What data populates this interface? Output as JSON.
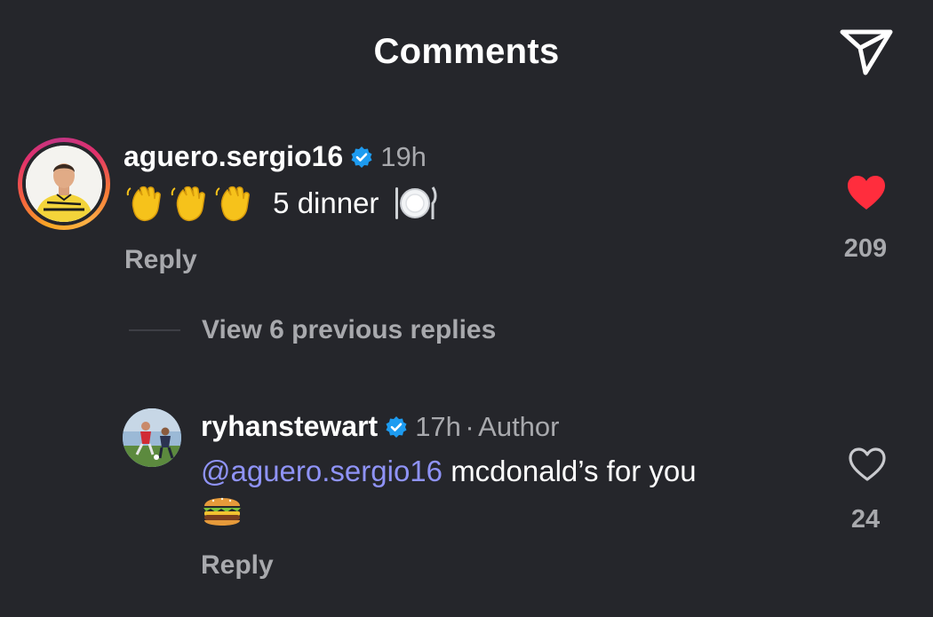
{
  "header": {
    "title": "Comments",
    "share_icon": "paper-plane-send-icon"
  },
  "comments": [
    {
      "username": "aguero.sergio16",
      "verified": true,
      "time": "19h",
      "text": "5 dinner",
      "emojis": [
        "waving-hand",
        "waving-hand",
        "waving-hand",
        "plate-with-cutlery"
      ],
      "likes": "209",
      "liked": true,
      "heart_color": "#ff2d3d",
      "reply_label": "Reply",
      "has_story_ring": true
    }
  ],
  "view_replies_label": "View 6 previous replies",
  "replies": [
    {
      "username": "ryhanstewart",
      "verified": true,
      "time": "17h",
      "separator": "·",
      "author_label": "Author",
      "mention": "@aguero.sergio16",
      "text": "mcdonald’s for you",
      "emojis": [
        "hamburger"
      ],
      "likes": "24",
      "liked": false,
      "reply_label": "Reply"
    }
  ],
  "colors": {
    "background": "#25262b",
    "secondary_text": "#a8a9ad",
    "mention": "#8f93f7",
    "verified_badge": "#1d9bf0",
    "like_red": "#ff2d3d"
  }
}
